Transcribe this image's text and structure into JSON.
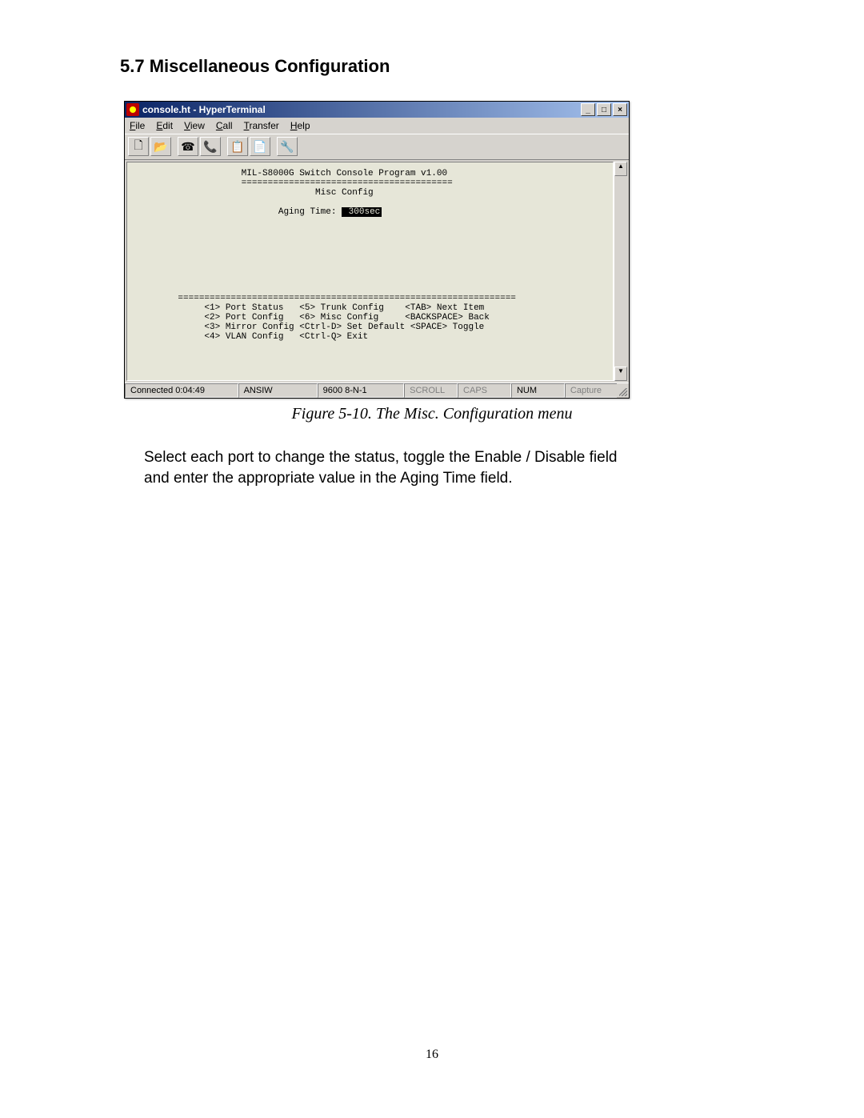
{
  "section_heading": "5.7 Miscellaneous Configuration",
  "window": {
    "title": "console.ht - HyperTerminal",
    "minimize_glyph": "_",
    "maximize_glyph": "□",
    "close_glyph": "×"
  },
  "menubar": {
    "items": [
      {
        "u": "F",
        "rest": "ile"
      },
      {
        "u": "E",
        "rest": "dit"
      },
      {
        "u": "V",
        "rest": "iew"
      },
      {
        "u": "C",
        "rest": "all"
      },
      {
        "u": "T",
        "rest": "ransfer"
      },
      {
        "u": "H",
        "rest": "elp"
      }
    ]
  },
  "toolbar": {
    "icons": [
      "🗋",
      "📂",
      "☎",
      "📞",
      "📋",
      "📄",
      "🔧"
    ]
  },
  "terminal": {
    "header": "MIL-S8000G Switch Console Program v1.00",
    "divider1": "========================================",
    "subtitle": "Misc Config",
    "aging_label": "Aging Time: ",
    "aging_value": " 300sec",
    "divider2": "================================================================",
    "line1": "<1> Port Status   <5> Trunk Config    <TAB> Next Item",
    "line2": "<2> Port Config   <6> Misc Config     <BACKSPACE> Back",
    "line3": "<3> Mirror Config <Ctrl-D> Set Default <SPACE> Toggle",
    "line4": "<4> VLAN Config   <Ctrl-Q> Exit"
  },
  "statusbar": {
    "connected": "Connected 0:04:49",
    "emulation": "ANSIW",
    "settings": "9600 8-N-1",
    "scroll": "SCROLL",
    "caps": "CAPS",
    "num": "NUM",
    "capture": "Capture"
  },
  "figure_caption": "Figure 5-10. The Misc. Configuration menu",
  "body_text": "Select each port to change the status, toggle the Enable / Disable field and enter the appropriate value in the Aging Time field.",
  "page_number": "16"
}
